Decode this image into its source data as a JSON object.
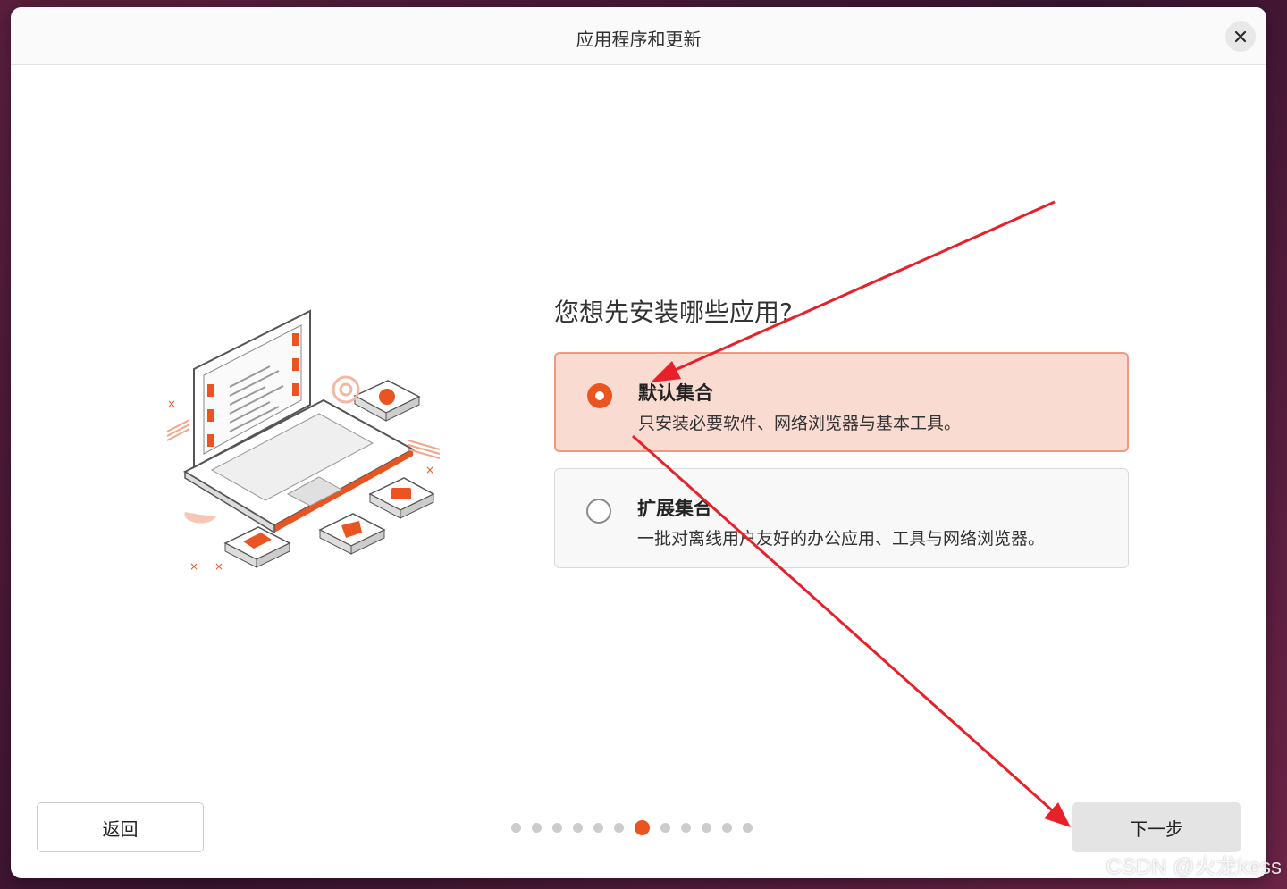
{
  "window": {
    "title": "应用程序和更新"
  },
  "main": {
    "question": "您想先安装哪些应用?",
    "options": [
      {
        "title": "默认集合",
        "description": "只安装必要软件、网络浏览器与基本工具。",
        "selected": true
      },
      {
        "title": "扩展集合",
        "description": "一批对离线用户友好的办公应用、工具与网络浏览器。",
        "selected": false
      }
    ]
  },
  "footer": {
    "back_label": "返回",
    "next_label": "下一步",
    "progress": {
      "total": 12,
      "current": 7
    }
  },
  "watermark": "CSDN @火龙kess",
  "colors": {
    "accent": "#e95420",
    "selected_bg": "#fadbd2",
    "annotation_arrow": "#e8202a"
  }
}
